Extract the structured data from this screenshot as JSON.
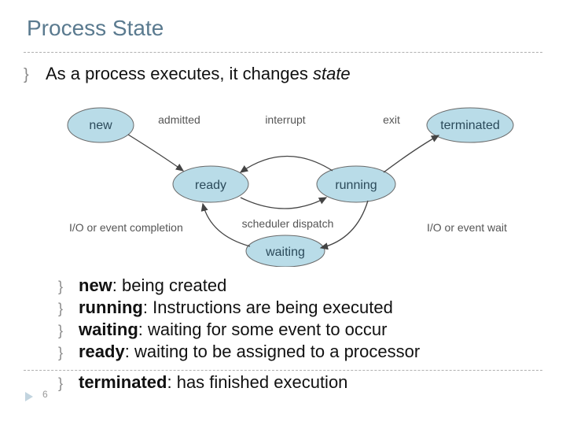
{
  "title": "Process State",
  "intro_prefix": "As a process executes, it changes ",
  "intro_italic": "state",
  "page_number": "6",
  "diagram": {
    "nodes": {
      "new": "new",
      "ready": "ready",
      "running": "running",
      "waiting": "waiting",
      "terminated": "terminated"
    },
    "edges": {
      "admitted": "admitted",
      "interrupt": "interrupt",
      "exit": "exit",
      "scheduler_dispatch": "scheduler dispatch",
      "io_completion": "I/O or event completion",
      "io_wait": "I/O or event wait"
    }
  },
  "bullets": [
    {
      "term": "new",
      "desc": ":  being created"
    },
    {
      "term": "running",
      "desc": ":  Instructions are being executed"
    },
    {
      "term": "waiting",
      "desc": ": waiting for some event to occur"
    },
    {
      "term": "ready",
      "desc": ":  waiting to be assigned to a processor"
    },
    {
      "term": "terminated",
      "desc": ": has finished execution"
    }
  ]
}
